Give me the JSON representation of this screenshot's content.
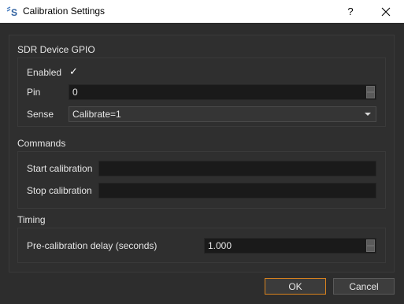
{
  "window": {
    "title": "Calibration Settings",
    "help": "?"
  },
  "sections": {
    "gpio": {
      "title": "SDR Device GPIO",
      "enabled_label": "Enabled",
      "enabled_checked": true,
      "pin_label": "Pin",
      "pin_value": "0",
      "sense_label": "Sense",
      "sense_value": "Calibrate=1"
    },
    "commands": {
      "title": "Commands",
      "start_label": "Start calibration",
      "start_value": "",
      "stop_label": "Stop calibration",
      "stop_value": ""
    },
    "timing": {
      "title": "Timing",
      "delay_label": "Pre-calibration delay (seconds)",
      "delay_value": "1.000"
    }
  },
  "buttons": {
    "ok": "OK",
    "cancel": "Cancel"
  },
  "colors": {
    "accent": "#d8821e",
    "background": "#2d2d2d",
    "field": "#1a1a1a"
  }
}
